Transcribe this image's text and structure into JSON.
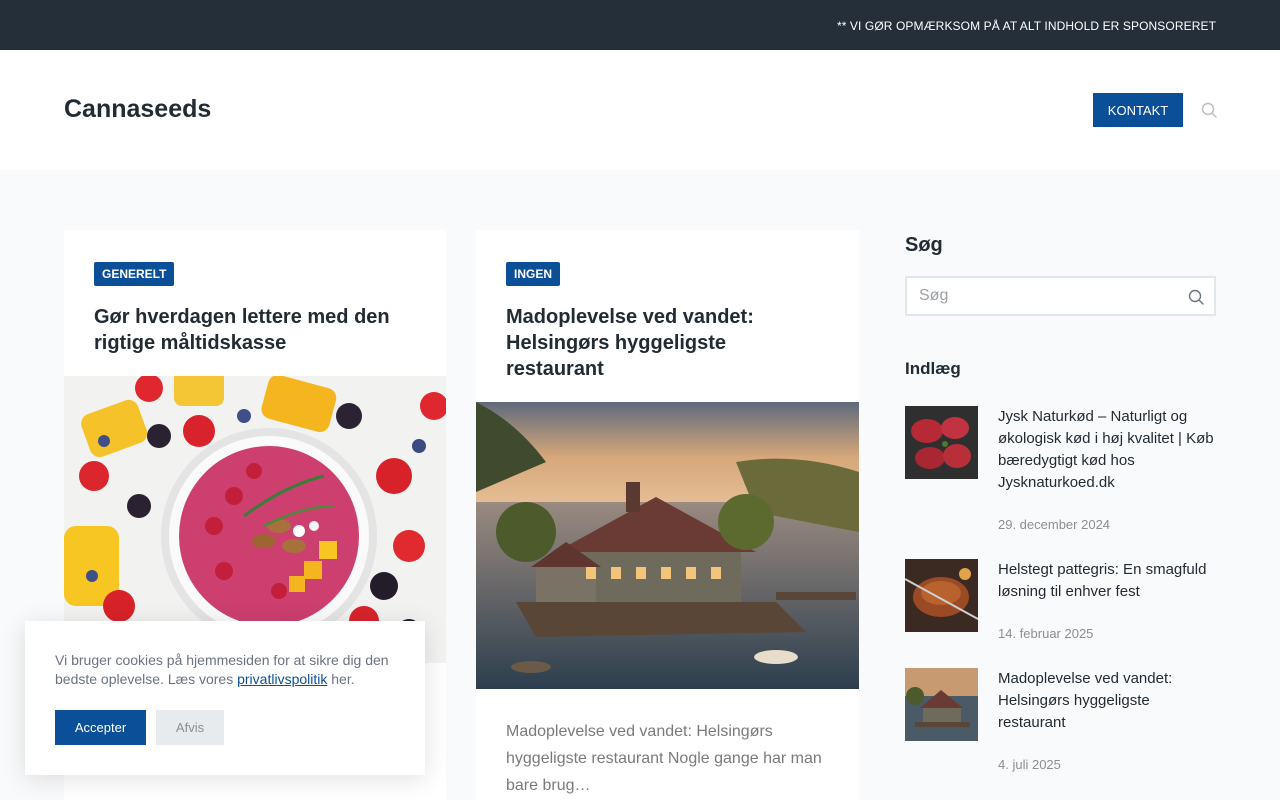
{
  "topbar": {
    "notice": "** VI GØR OPMÆRKSOM PÅ AT ALT INDHOLD ER SPONSORERET"
  },
  "header": {
    "logo": "Cannaseeds",
    "contact_label": "KONTAKT",
    "search_icon": "search-icon"
  },
  "posts": [
    {
      "category": "GENERELT",
      "title": "Gør hverdagen lettere med den rigtige måltidskasse"
    },
    {
      "category": "INGEN",
      "title": "Madoplevelse ved vandet: Helsingørs hyggeligste restaurant",
      "excerpt": "Madoplevelse ved vandet: Helsingørs hyggeligste restaurant Nogle gange har man bare brug…"
    }
  ],
  "sidebar": {
    "search_heading": "Søg",
    "search_placeholder": "Søg",
    "posts_heading": "Indlæg",
    "recent": [
      {
        "title": "Jysk Naturkød – Naturligt og økologisk kød i høj kvalitet | Køb bæredygtigt kød hos Jysknaturkoed.dk",
        "date": "29. december 2024"
      },
      {
        "title": "Helstegt pattegris: En smagfuld løsning til enhver fest",
        "date": "14. februar 2025"
      },
      {
        "title": "Madoplevelse ved vandet: Helsingørs hyggeligste restaurant",
        "date": "4. juli 2025"
      }
    ]
  },
  "cookie": {
    "text_before": "Vi bruger cookies på hjemmesiden for at sikre dig den bedste oplevelse. Læs vores",
    "link": "privatlivspolitik",
    "text_after": "her.",
    "accept": "Accepter",
    "reject": "Afvis"
  },
  "colors": {
    "accent": "#0b4f98",
    "topbar": "#242f3a",
    "background": "#f9fafb"
  }
}
